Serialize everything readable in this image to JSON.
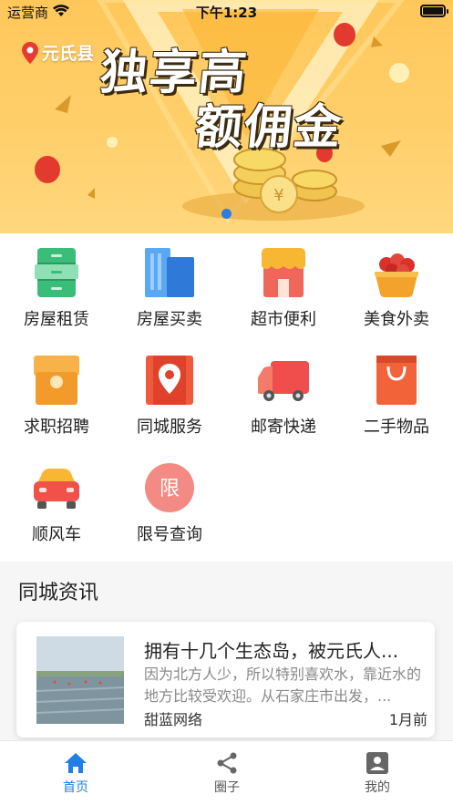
{
  "status_bar": {
    "carrier": "运营商",
    "time": "下午1:23"
  },
  "banner": {
    "location": "元氏县",
    "promo_line1": "独享高",
    "promo_line2": "额佣金"
  },
  "grid": {
    "items": [
      {
        "label": "房屋租赁",
        "icon": "cabinet-icon",
        "color": "#3bbd7a"
      },
      {
        "label": "房屋买卖",
        "icon": "buildings-icon",
        "color": "#3a8fe6"
      },
      {
        "label": "超市便利",
        "icon": "store-icon",
        "color": "#f0665a"
      },
      {
        "label": "美食外卖",
        "icon": "fruit-basket-icon",
        "color": "#f3a32c"
      },
      {
        "label": "求职招聘",
        "icon": "briefcase-icon",
        "color": "#f7b34a"
      },
      {
        "label": "同城服务",
        "icon": "map-pin-icon",
        "color": "#f05a3c"
      },
      {
        "label": "邮寄快递",
        "icon": "truck-icon",
        "color": "#f04d4d"
      },
      {
        "label": "二手物品",
        "icon": "shopping-bag-icon",
        "color": "#f2633a"
      },
      {
        "label": "顺风车",
        "icon": "car-icon",
        "color": "#f15148"
      },
      {
        "label": "限号查询",
        "icon": "limit-badge-icon",
        "color": "#f38b84",
        "badge_text": "限"
      }
    ]
  },
  "news": {
    "section_title": "同城资讯",
    "article": {
      "title": "拥有十几个生态岛，被元氏人...",
      "summary": "因为北方人少，所以特别喜欢水，靠近水的地方比较受欢迎。从石家庄市出发，...",
      "source": "甜蓝网络",
      "time": "1月前"
    }
  },
  "tabbar": {
    "tabs": [
      {
        "label": "首页",
        "icon": "home-icon",
        "active": true
      },
      {
        "label": "圈子",
        "icon": "share-icon",
        "active": false
      },
      {
        "label": "我的",
        "icon": "profile-icon",
        "active": false
      }
    ],
    "active_color": "#1f7fe6"
  }
}
